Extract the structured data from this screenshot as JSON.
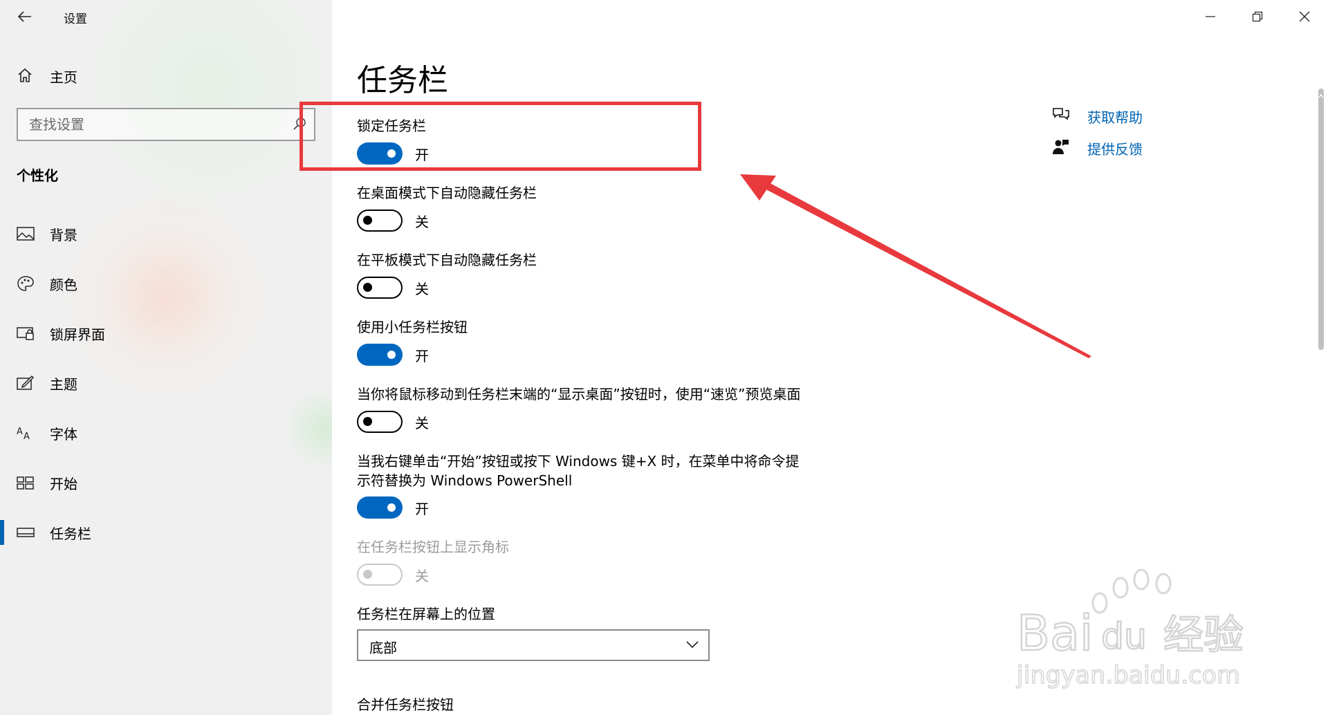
{
  "window": {
    "title": "设置",
    "controls": [
      "minimize-icon",
      "restore-icon",
      "close-icon"
    ]
  },
  "sidebar": {
    "home_label": "主页",
    "search_placeholder": "查找设置",
    "section_title": "个性化",
    "items": [
      {
        "label": "背景",
        "icon": "picture-icon",
        "active": false
      },
      {
        "label": "颜色",
        "icon": "palette-icon",
        "active": false
      },
      {
        "label": "锁屏界面",
        "icon": "lockscreen-icon",
        "active": false
      },
      {
        "label": "主题",
        "icon": "theme-icon",
        "active": false
      },
      {
        "label": "字体",
        "icon": "font-icon",
        "active": false
      },
      {
        "label": "开始",
        "icon": "start-icon",
        "active": false
      },
      {
        "label": "任务栏",
        "icon": "taskbar-icon",
        "active": true
      }
    ]
  },
  "main": {
    "page_title": "任务栏",
    "settings": [
      {
        "label": "锁定任务栏",
        "state": "开",
        "on": true,
        "enabled": true
      },
      {
        "label": "在桌面模式下自动隐藏任务栏",
        "state": "关",
        "on": false,
        "enabled": true
      },
      {
        "label": "在平板模式下自动隐藏任务栏",
        "state": "关",
        "on": false,
        "enabled": true
      },
      {
        "label": "使用小任务栏按钮",
        "state": "开",
        "on": true,
        "enabled": true
      },
      {
        "label": "当你将鼠标移动到任务栏末端的“显示桌面”按钮时，使用“速览”预览桌面",
        "state": "关",
        "on": false,
        "enabled": true
      },
      {
        "label_line1": "当我右键单击“开始”按钮或按下 Windows 键+X 时，在菜单中将命令提",
        "label_line2": "示符替换为 Windows PowerShell",
        "state": "开",
        "on": true,
        "enabled": true
      },
      {
        "label": "在任务栏按钮上显示角标",
        "state": "关",
        "on": false,
        "enabled": false
      }
    ],
    "position": {
      "label": "任务栏在屏幕上的位置",
      "value": "底部"
    },
    "combine_label": "合并任务栏按钮"
  },
  "help_links": {
    "get_help": "获取帮助",
    "feedback": "提供反馈"
  },
  "annotation": {
    "color": "#e8393d"
  },
  "watermark": {
    "line1": "Bai",
    "line2": "du",
    "line3": "经验",
    "url": "jingyan.baidu.com"
  },
  "colors": {
    "accent": "#0067c0",
    "link": "#0063b1",
    "disabled": "#9c9c9c"
  }
}
